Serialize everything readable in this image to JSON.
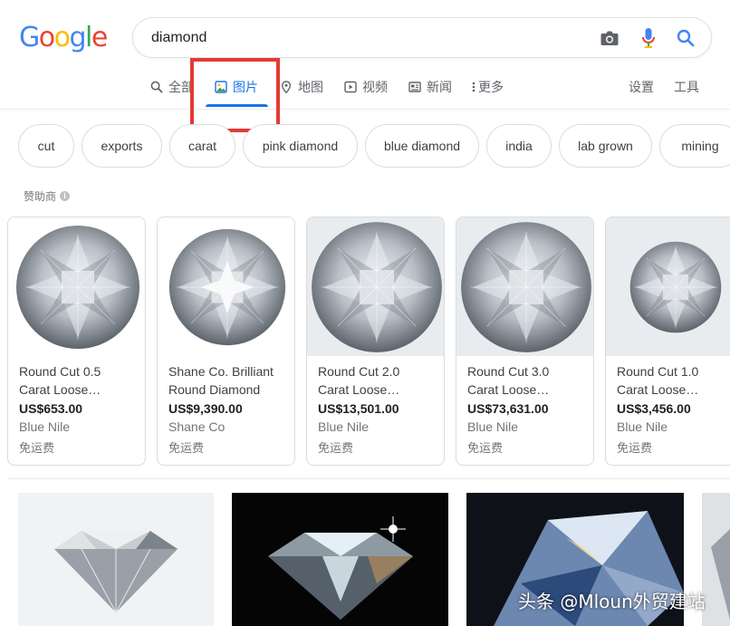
{
  "logo": {
    "letters": [
      "G",
      "o",
      "o",
      "g",
      "l",
      "e"
    ],
    "colors": [
      "#4285f4",
      "#ea4335",
      "#fbbc05",
      "#4285f4",
      "#34a853",
      "#ea4335"
    ]
  },
  "search": {
    "value": "diamond",
    "placeholder": ""
  },
  "tabs": [
    {
      "label": "全部",
      "icon": "search-icon"
    },
    {
      "label": "图片",
      "icon": "image-icon",
      "active": true
    },
    {
      "label": "地图",
      "icon": "map-pin-icon"
    },
    {
      "label": "视频",
      "icon": "video-icon"
    },
    {
      "label": "新闻",
      "icon": "news-icon"
    },
    {
      "label": "更多",
      "icon": "more-vert-icon"
    }
  ],
  "tools": {
    "settings": "设置",
    "tools": "工具"
  },
  "chips": [
    "cut",
    "exports",
    "carat",
    "pink diamond",
    "blue diamond",
    "india",
    "lab grown",
    "mining"
  ],
  "sponsored": {
    "label": "赞助商"
  },
  "products": [
    {
      "title1": "Round Cut 0.5",
      "title2": "Carat Loose…",
      "price": "US$653.00",
      "merchant": "Blue Nile",
      "shipping": "免运费"
    },
    {
      "title1": "Shane Co. Brilliant",
      "title2": "Round Diamond",
      "price": "US$9,390.00",
      "merchant": "Shane Co",
      "shipping": "免运费"
    },
    {
      "title1": "Round Cut 2.0",
      "title2": "Carat Loose…",
      "price": "US$13,501.00",
      "merchant": "Blue Nile",
      "shipping": "免运费"
    },
    {
      "title1": "Round Cut 3.0",
      "title2": "Carat Loose…",
      "price": "US$73,631.00",
      "merchant": "Blue Nile",
      "shipping": "免运费"
    },
    {
      "title1": "Round Cut 1.0",
      "title2": "Carat Loose…",
      "price": "US$3,456.00",
      "merchant": "Blue Nile",
      "shipping": "免运费"
    }
  ],
  "watermark": "头条 @Mloun外贸建站",
  "colors": {
    "accent": "#1a73e8",
    "highlight": "#e53935"
  }
}
